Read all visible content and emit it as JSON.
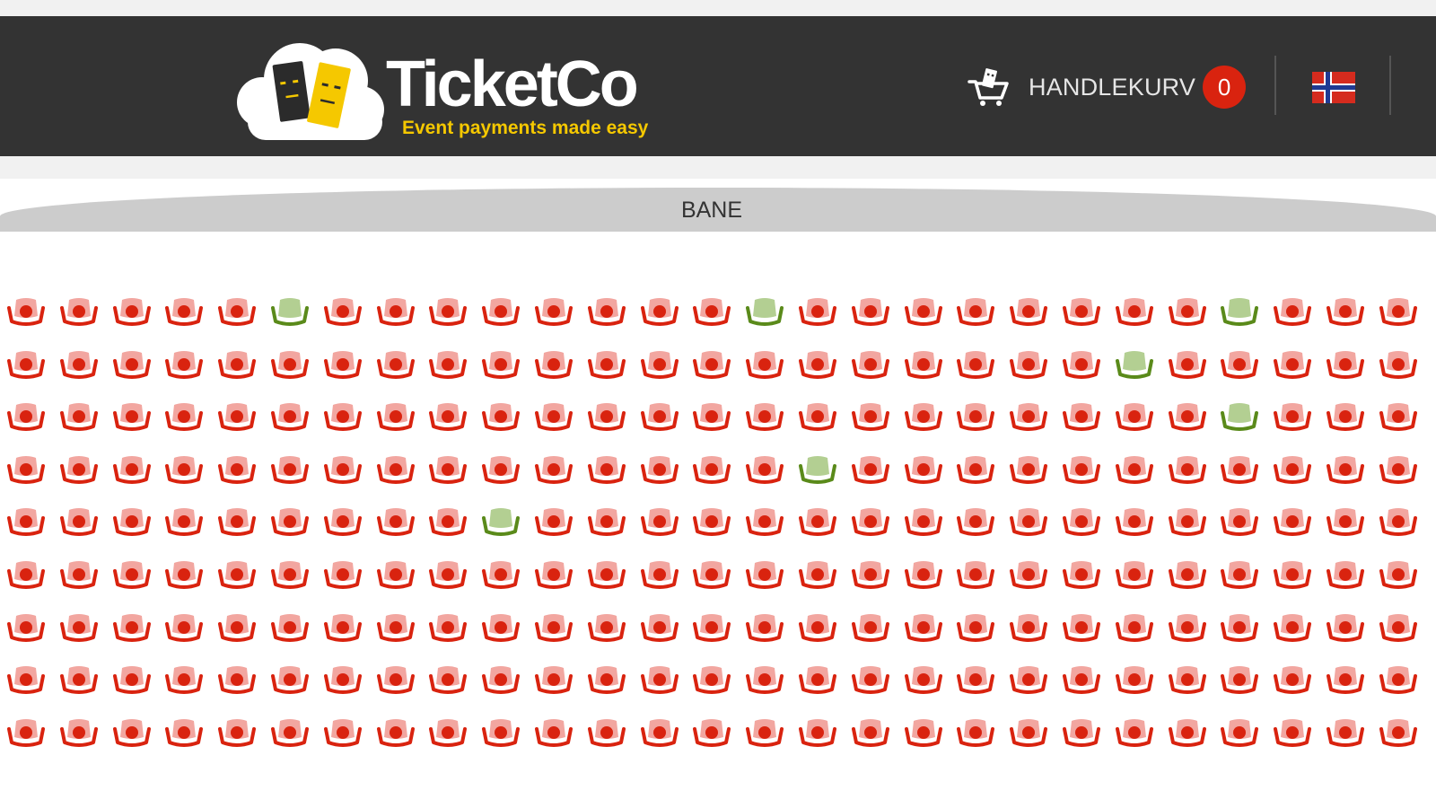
{
  "header": {
    "logo": {
      "name": "TicketCo",
      "tagline": "Event payments made easy"
    },
    "cart": {
      "icon": "shopping-cart-icon",
      "label": "HANDLEKURV",
      "count": "0"
    },
    "language_flag": "norwegian-flag-icon"
  },
  "venue": {
    "stage_label": "BANE"
  },
  "seat_map": {
    "rows": 9,
    "seats_per_row": 27,
    "legend_colors": {
      "taken_fill": "#f2a6a0",
      "taken_outline": "#d9230f",
      "available_fill": "#b3cf92",
      "available_outline": "#5a8a1a"
    },
    "available_seats": [
      {
        "row": 1,
        "seat": 6
      },
      {
        "row": 1,
        "seat": 15
      },
      {
        "row": 1,
        "seat": 24
      },
      {
        "row": 2,
        "seat": 22
      },
      {
        "row": 3,
        "seat": 24
      },
      {
        "row": 4,
        "seat": 16
      },
      {
        "row": 5,
        "seat": 10
      }
    ]
  }
}
